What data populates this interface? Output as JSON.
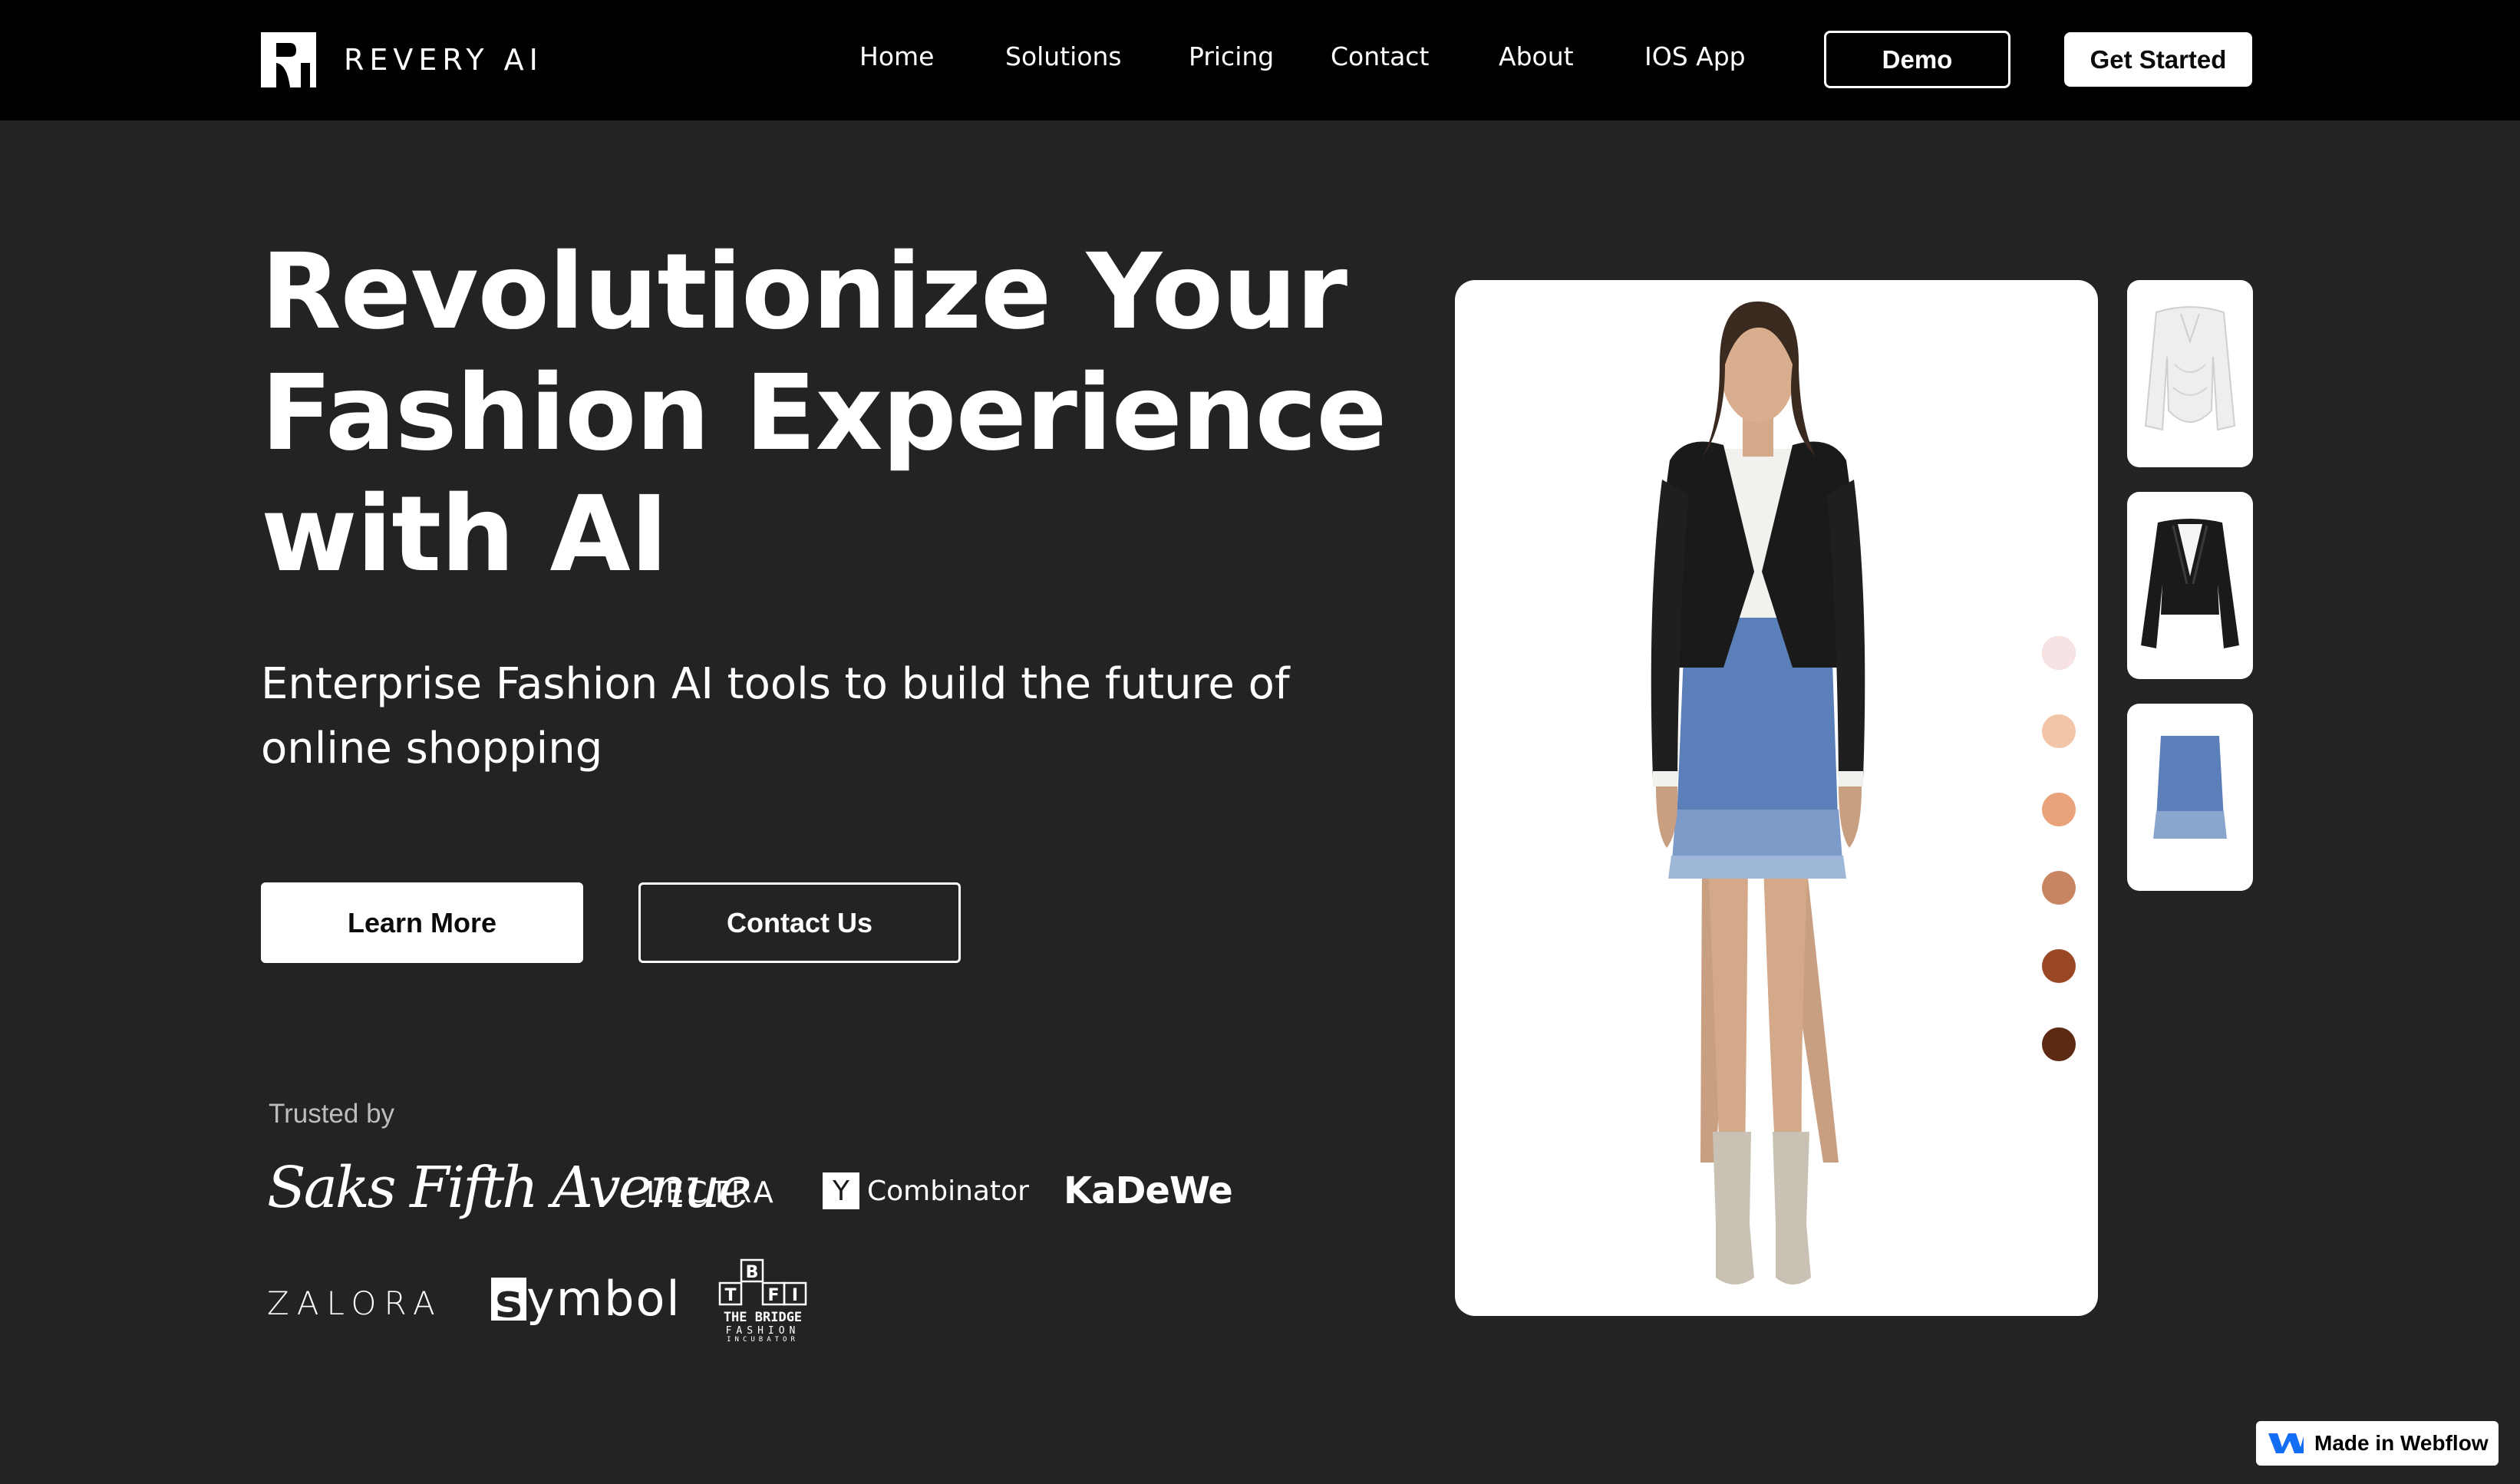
{
  "brand": {
    "name": "REVERY AI"
  },
  "nav": {
    "links": [
      "Home",
      "Solutions",
      "Pricing",
      "Contact",
      "About",
      "IOS App"
    ],
    "demo_label": "Demo",
    "get_started_label": "Get Started"
  },
  "hero": {
    "title_lines": [
      "Revolutionize Your",
      "Fashion Experience",
      "with AI"
    ],
    "subtitle": "Enterprise Fashion AI tools to build the future of online shopping",
    "learn_more_label": "Learn More",
    "contact_label": "Contact Us"
  },
  "trusted": {
    "label": "Trusted by",
    "logos": {
      "saks": "Saks Fifth Avenue",
      "lectra": "LECTRA",
      "yc_box": "Y",
      "yc_text": "Combinator",
      "kadewe": "KaDeWe",
      "zalora": "ZALORA",
      "symbol_box": "s",
      "symbol_text": "ymbol",
      "bridge_letters": [
        "B",
        "T",
        "F",
        "I"
      ],
      "bridge_text": "THE BRIDGE",
      "bridge_sub": "FASHION",
      "bridge_sub2": "INCUBATOR"
    }
  },
  "tryon": {
    "skin_tone_swatches": [
      "#f8e3e4",
      "#f2c4a8",
      "#eaa27a",
      "#c98461",
      "#9a4824",
      "#5c2a12"
    ],
    "thumbnails": [
      "white-corset-top",
      "black-leather-jacket",
      "blue-tweed-skirt"
    ]
  },
  "badge": {
    "label": "Made in Webflow",
    "accent": "#146ef5"
  }
}
